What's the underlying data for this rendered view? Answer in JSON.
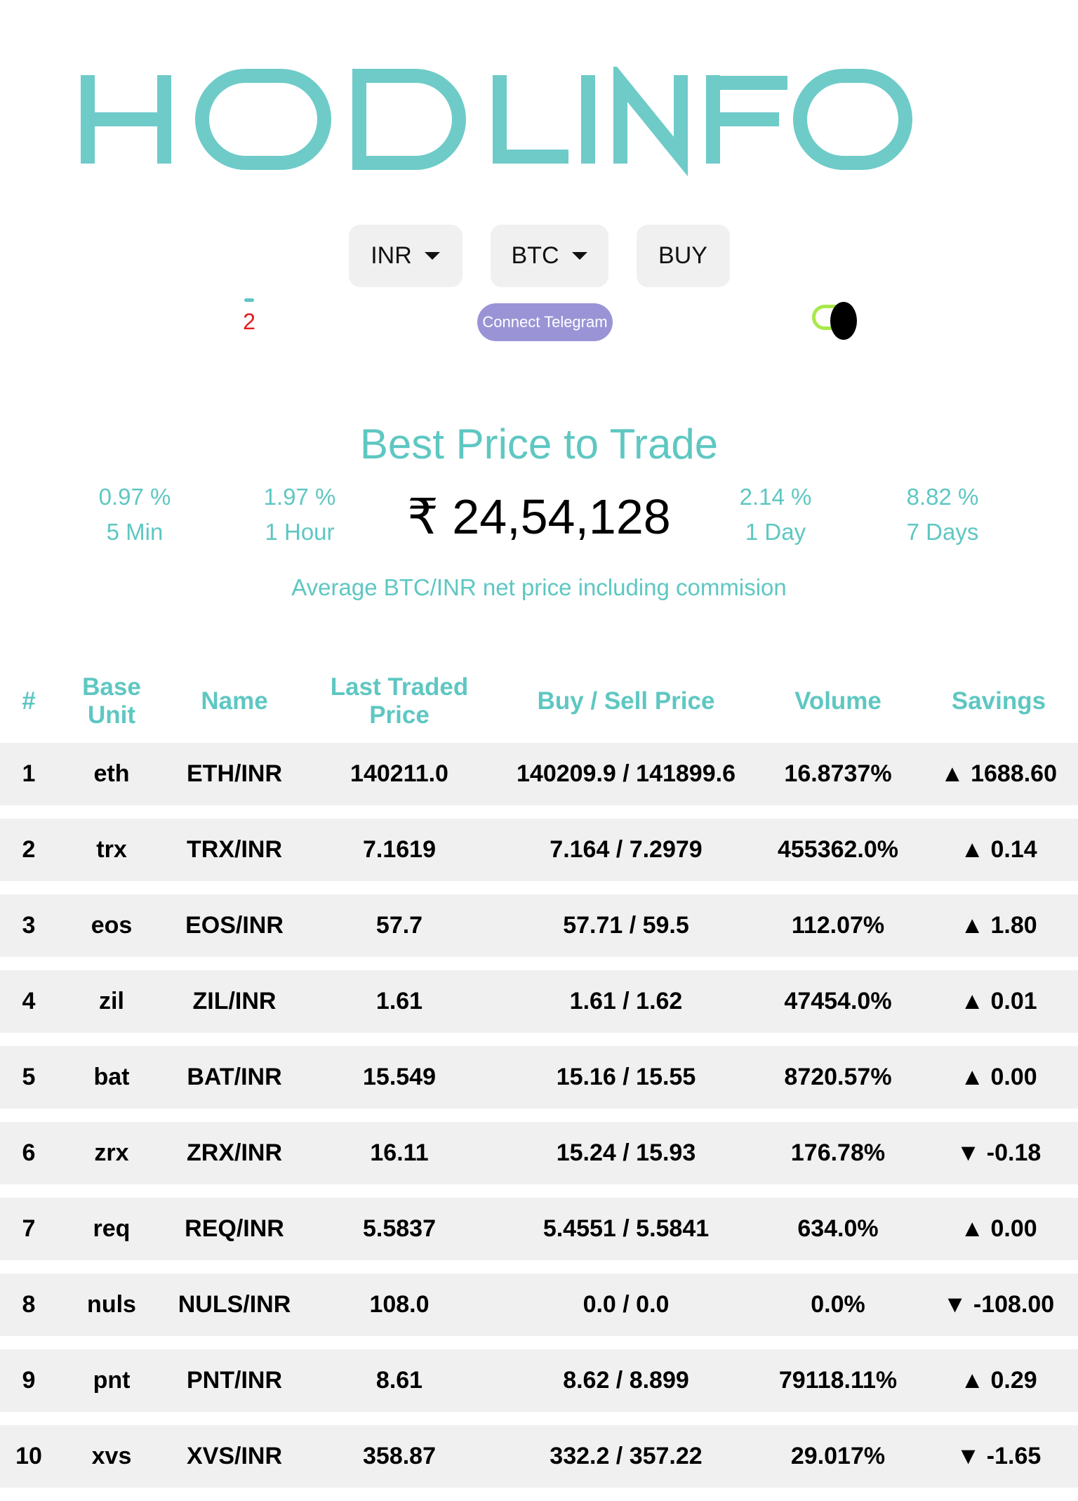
{
  "brand": {
    "logo_text": "HODLINFO",
    "logo_color": "#6ecbc8"
  },
  "controls": {
    "currency": "INR",
    "asset": "BTC",
    "action": "BUY"
  },
  "timer": {
    "countdown": "2"
  },
  "telegram": {
    "label": "Connect Telegram"
  },
  "theme_toggle": {
    "state": "dark"
  },
  "summary": {
    "title": "Best Price to Trade",
    "price": "₹ 24,54,128",
    "note": "Average BTC/INR net price including commision",
    "stats": [
      {
        "percent": "0.97 %",
        "period": "5 Min"
      },
      {
        "percent": "1.97 %",
        "period": "1 Hour"
      },
      {
        "percent": "2.14 %",
        "period": "1 Day"
      },
      {
        "percent": "8.82 %",
        "period": "7 Days"
      }
    ]
  },
  "table": {
    "headers": [
      "#",
      "Base Unit",
      "Name",
      "Last Traded Price",
      "Buy / Sell Price",
      "Volume",
      "Savings"
    ],
    "rows": [
      [
        "1",
        "eth",
        "ETH/INR",
        "140211.0",
        "140209.9 / 141899.6",
        "16.8737%",
        "▲ 1688.60"
      ],
      [
        "2",
        "trx",
        "TRX/INR",
        "7.1619",
        "7.164 / 7.2979",
        "455362.0%",
        "▲ 0.14"
      ],
      [
        "3",
        "eos",
        "EOS/INR",
        "57.7",
        "57.71 / 59.5",
        "112.07%",
        "▲ 1.80"
      ],
      [
        "4",
        "zil",
        "ZIL/INR",
        "1.61",
        "1.61 / 1.62",
        "47454.0%",
        "▲ 0.01"
      ],
      [
        "5",
        "bat",
        "BAT/INR",
        "15.549",
        "15.16 / 15.55",
        "8720.57%",
        "▲ 0.00"
      ],
      [
        "6",
        "zrx",
        "ZRX/INR",
        "16.11",
        "15.24 / 15.93",
        "176.78%",
        "▼ -0.18"
      ],
      [
        "7",
        "req",
        "REQ/INR",
        "5.5837",
        "5.4551 / 5.5841",
        "634.0%",
        "▲ 0.00"
      ],
      [
        "8",
        "nuls",
        "NULS/INR",
        "108.0",
        "0.0 / 0.0",
        "0.0%",
        "▼ -108.00"
      ],
      [
        "9",
        "pnt",
        "PNT/INR",
        "8.61",
        "8.62 / 8.899",
        "79118.11%",
        "▲ 0.29"
      ],
      [
        "10",
        "xvs",
        "XVS/INR",
        "358.87",
        "332.2 / 357.22",
        "29.017%",
        "▼ -1.65"
      ]
    ]
  }
}
